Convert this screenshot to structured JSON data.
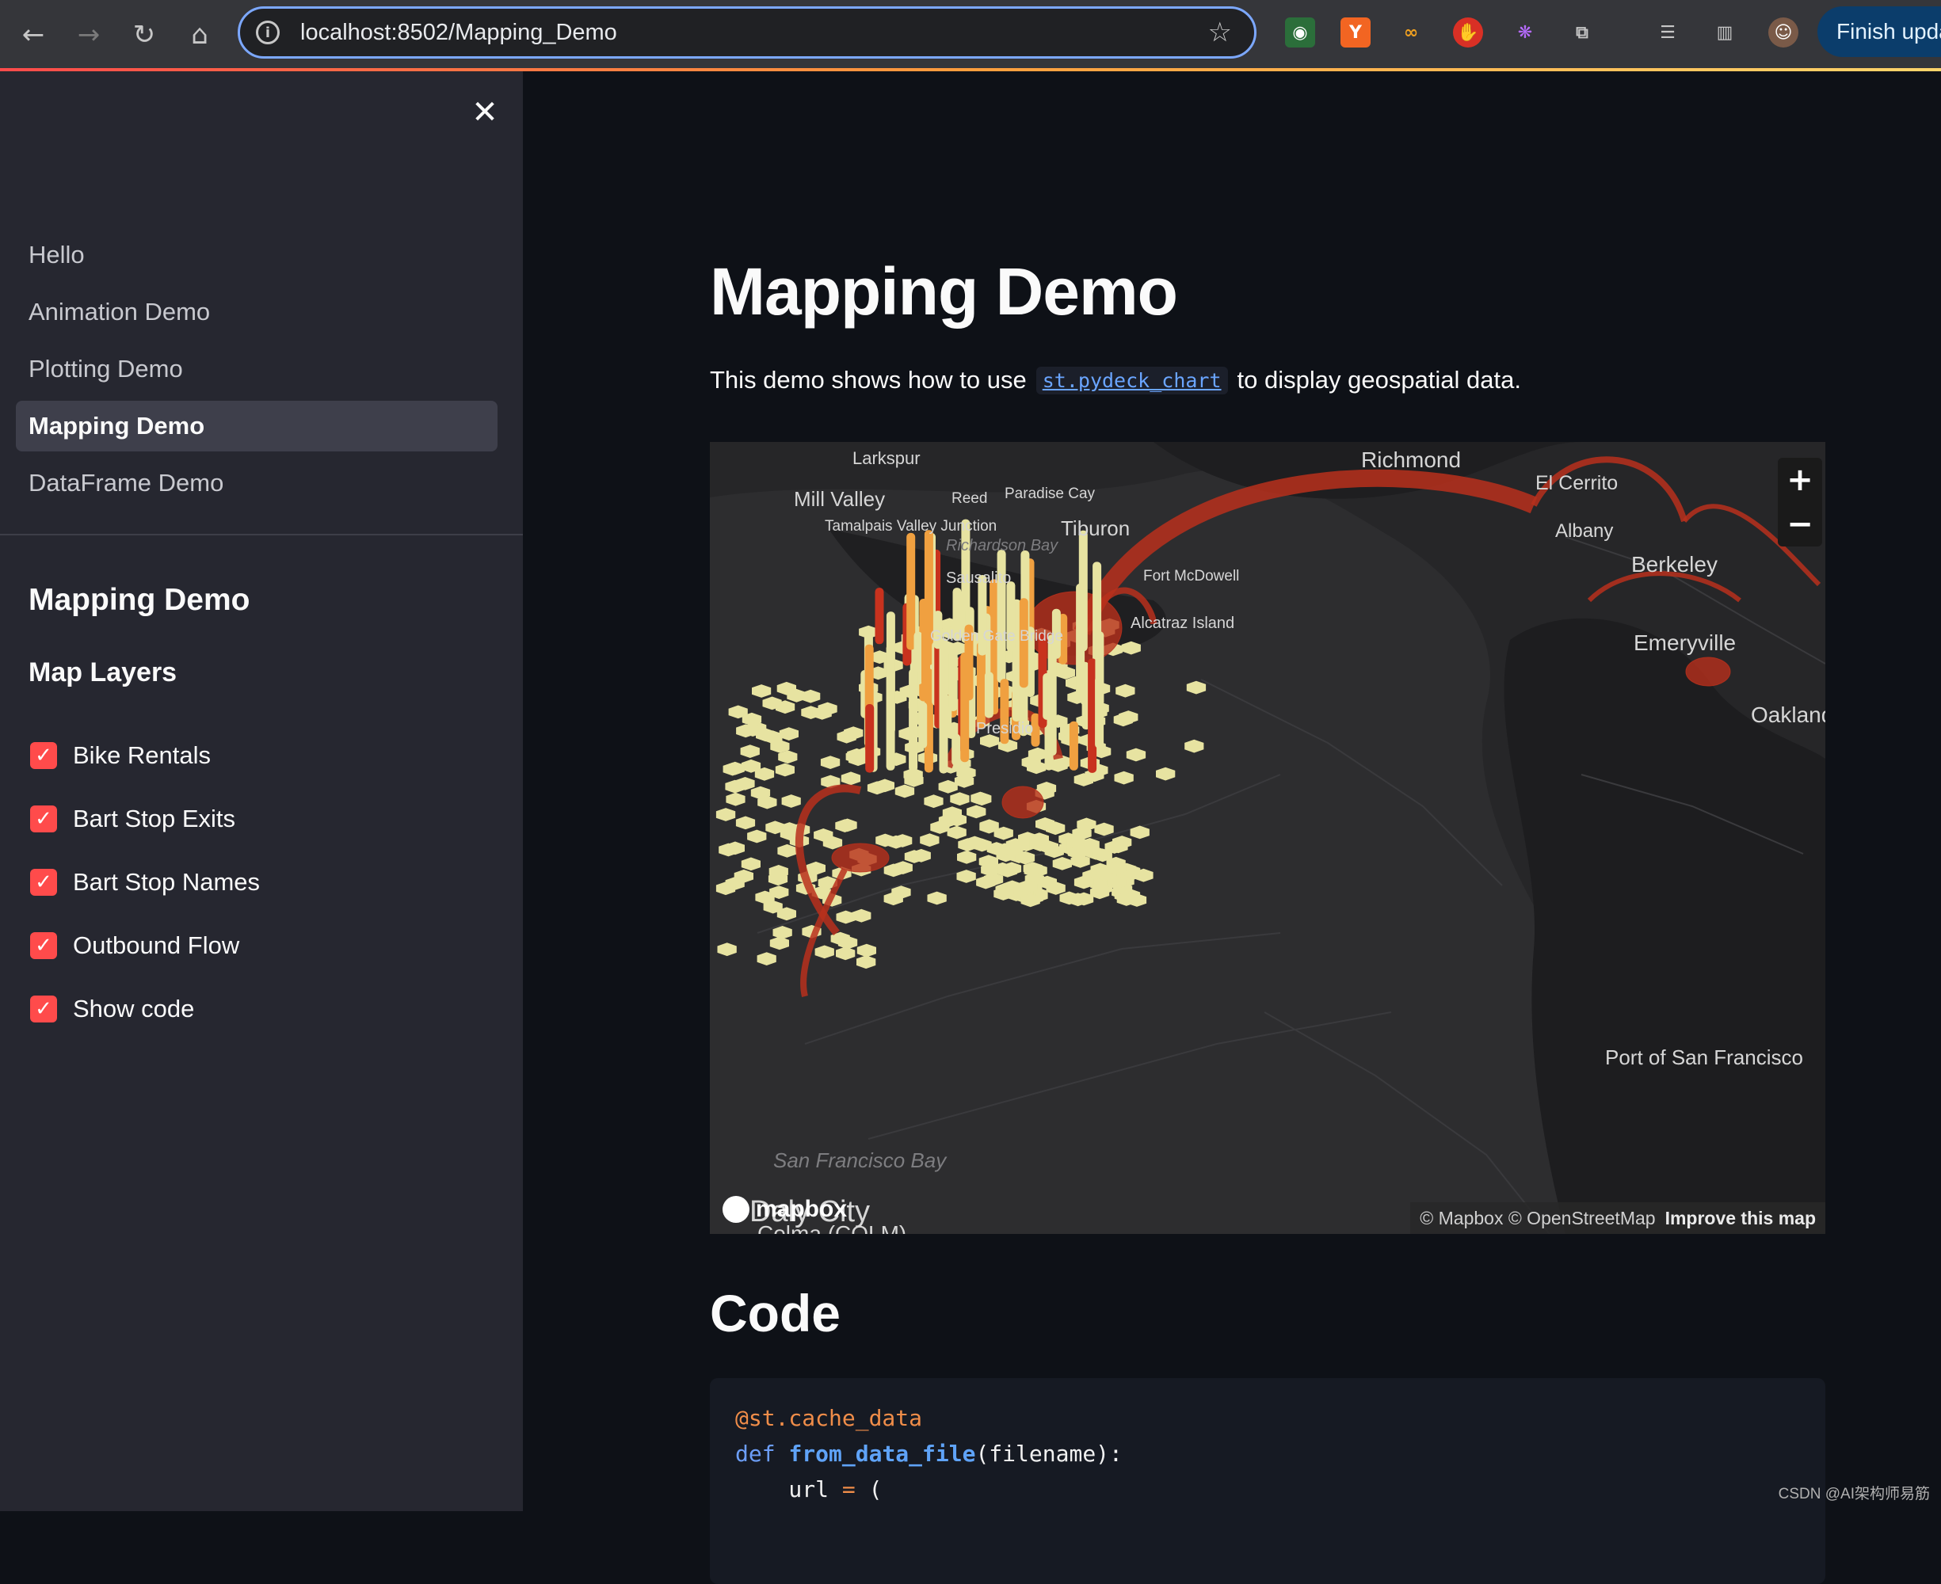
{
  "browser": {
    "url": "localhost:8502/Mapping_Demo",
    "finish_update_label": "Finish upda",
    "extensions": [
      "on-extension-icon",
      "y-extension-icon",
      "co-extension-icon",
      "hand-extension-icon",
      "brain-extension-icon",
      "puzzle-icon",
      "reading-list-icon",
      "side-panel-icon",
      "profile-avatar"
    ]
  },
  "sidebar": {
    "nav": [
      {
        "label": "Hello",
        "active": false
      },
      {
        "label": "Animation Demo",
        "active": false
      },
      {
        "label": "Plotting Demo",
        "active": false
      },
      {
        "label": "Mapping Demo",
        "active": true
      },
      {
        "label": "DataFrame Demo",
        "active": false
      }
    ],
    "title": "Mapping Demo",
    "subtitle": "Map Layers",
    "layers": [
      {
        "label": "Bike Rentals",
        "checked": true
      },
      {
        "label": "Bart Stop Exits",
        "checked": true
      },
      {
        "label": "Bart Stop Names",
        "checked": true
      },
      {
        "label": "Outbound Flow",
        "checked": true
      },
      {
        "label": "Show code",
        "checked": true
      }
    ]
  },
  "main": {
    "title": "Mapping Demo",
    "intro_before": "This demo shows how to use",
    "intro_code": "st.pydeck_chart",
    "intro_after": "to display geospatial data.",
    "code_title": "Code"
  },
  "map": {
    "place_labels": [
      "Larkspur",
      "Richmond",
      "El Cerrito",
      "Mill Valley",
      "Reed",
      "Paradise Cay",
      "Tamalpais Valley Junction",
      "Tiburon",
      "Richardson Bay",
      "Albany",
      "Berkeley",
      "Sausalito",
      "Fort McDowell",
      "Emeryville",
      "Golden Gate Bridge",
      "Alcatraz Island",
      "Oakland",
      "Presidio",
      "Port of San Francisco",
      "San Francisco Bay",
      "Daly City",
      "Colma (COLM)"
    ],
    "attribution_left": "© Mapbox © OpenStreetMap",
    "attribution_right": "Improve this map",
    "logo": "mapbox",
    "zoom_in": "+",
    "zoom_out": "−",
    "colors": {
      "low": "#e7e3a1",
      "mid": "#f0a040",
      "high": "#c8321e",
      "arc": "#b8301c"
    }
  },
  "code": {
    "lines": [
      [
        {
          "t": "@st.cache_data",
          "c": "dec"
        }
      ],
      [
        {
          "t": "def ",
          "c": "kw"
        },
        {
          "t": "from_data_file",
          "c": "fn"
        },
        {
          "t": "(filename):",
          "c": "plain"
        }
      ],
      [
        {
          "t": "    url ",
          "c": "plain"
        },
        {
          "t": "=",
          "c": "op"
        },
        {
          "t": " (",
          "c": "plain"
        }
      ]
    ]
  },
  "watermark": "CSDN @AI架构师易筋"
}
